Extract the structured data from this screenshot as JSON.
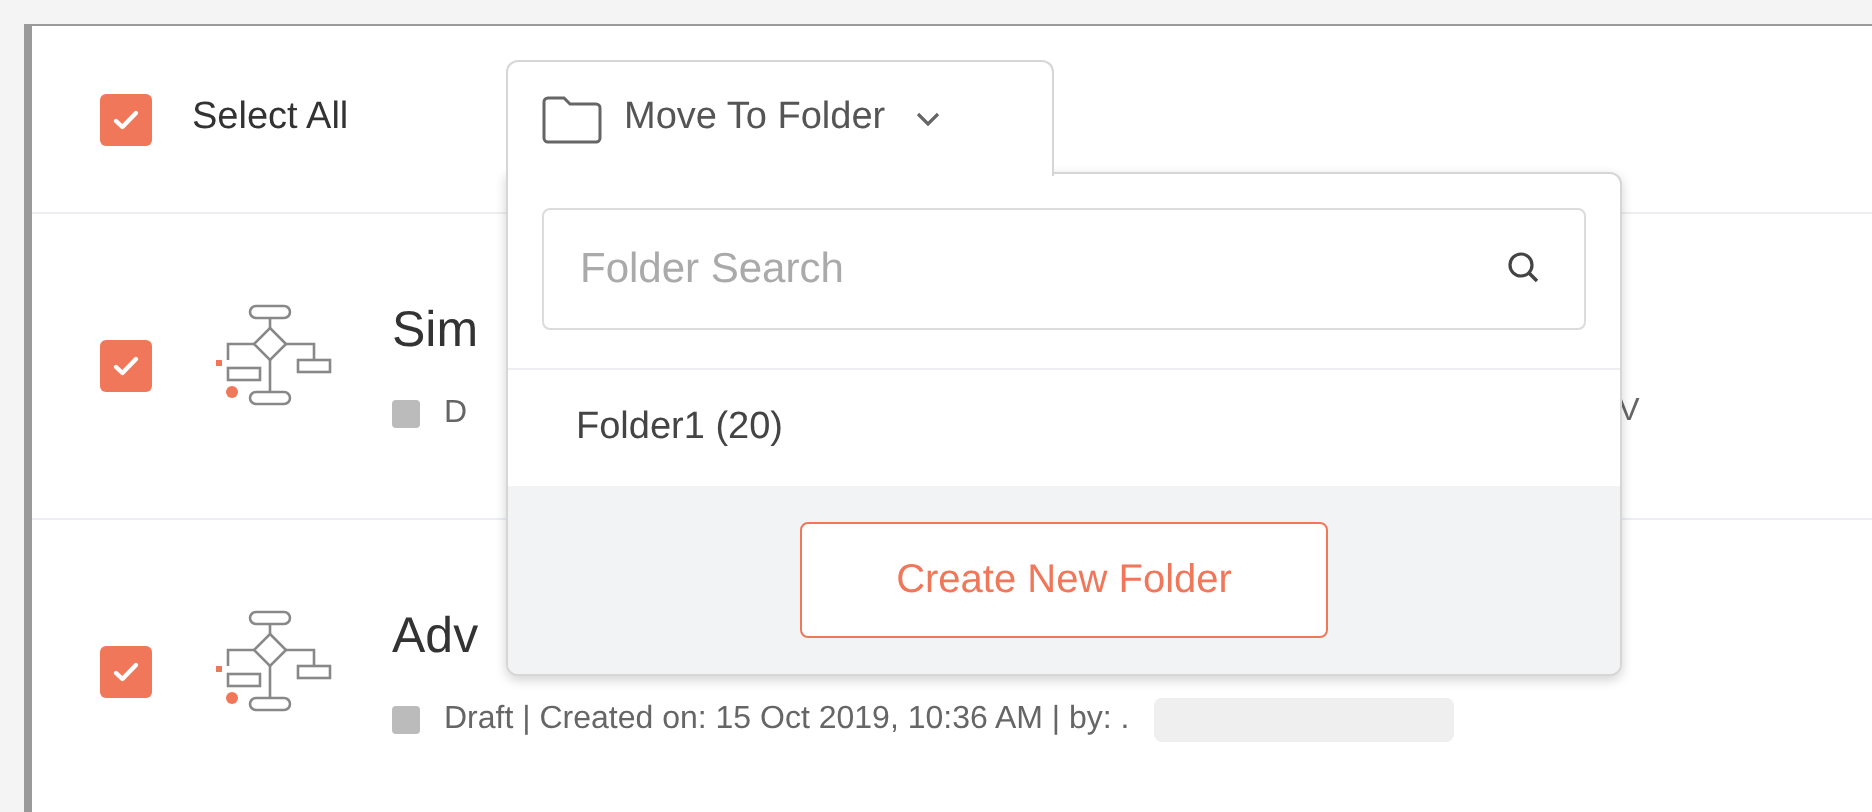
{
  "select_all": {
    "label": "Select All",
    "checked": true
  },
  "move_button": {
    "label": "Move To Folder"
  },
  "dropdown": {
    "search": {
      "placeholder": "Folder Search"
    },
    "folders": [
      {
        "label": "Folder1 (20)"
      }
    ],
    "create_button": "Create New Folder"
  },
  "rows": [
    {
      "checked": true,
      "title": "Sim",
      "meta": "D",
      "meta_end": "V",
      "redacted": false
    },
    {
      "checked": true,
      "title": "Adv",
      "meta": "Draft | Created on: 15 Oct 2019, 10:36 AM | by: .",
      "meta_end": "",
      "redacted": true
    }
  ]
}
